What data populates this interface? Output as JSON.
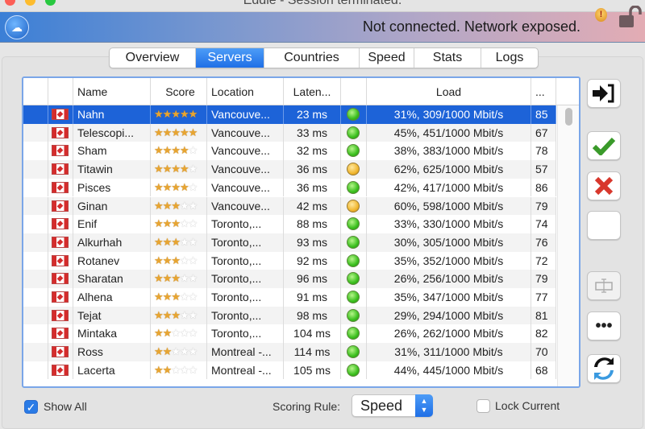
{
  "window": {
    "title": "Eddie - Session terminated."
  },
  "banner": {
    "status": "Not connected. Network exposed.",
    "logo_icon": "cloud-icon",
    "warning_icon": "warning-icon",
    "lock_icon": "unlocked-padlock-icon"
  },
  "tabs": [
    {
      "label": "Overview",
      "active": false
    },
    {
      "label": "Servers",
      "active": true
    },
    {
      "label": "Countries",
      "active": false
    },
    {
      "label": "Speed",
      "active": false
    },
    {
      "label": "Stats",
      "active": false
    },
    {
      "label": "Logs",
      "active": false
    }
  ],
  "table": {
    "columns": [
      "",
      "",
      "Name",
      "Score",
      "Location",
      "Laten...",
      "",
      "Load",
      "..."
    ],
    "rows": [
      {
        "name": "Nahn",
        "stars": 5,
        "location": "Vancouve...",
        "latency": "23 ms",
        "status": "green",
        "load": "31%, 309/1000 Mbit/s",
        "users": "85",
        "selected": true
      },
      {
        "name": "Telescopi...",
        "stars": 5,
        "location": "Vancouve...",
        "latency": "33 ms",
        "status": "green",
        "load": "45%, 451/1000 Mbit/s",
        "users": "67"
      },
      {
        "name": "Sham",
        "stars": 4,
        "location": "Vancouve...",
        "latency": "32 ms",
        "status": "green",
        "load": "38%, 383/1000 Mbit/s",
        "users": "78"
      },
      {
        "name": "Titawin",
        "stars": 4,
        "location": "Vancouve...",
        "latency": "36 ms",
        "status": "yellow",
        "load": "62%, 625/1000 Mbit/s",
        "users": "57"
      },
      {
        "name": "Pisces",
        "stars": 4,
        "location": "Vancouve...",
        "latency": "36 ms",
        "status": "green",
        "load": "42%, 417/1000 Mbit/s",
        "users": "86"
      },
      {
        "name": "Ginan",
        "stars": 3,
        "location": "Vancouve...",
        "latency": "42 ms",
        "status": "yellow",
        "load": "60%, 598/1000 Mbit/s",
        "users": "79"
      },
      {
        "name": "Enif",
        "stars": 3,
        "location": "Toronto,...",
        "latency": "88 ms",
        "status": "green",
        "load": "33%, 330/1000 Mbit/s",
        "users": "74"
      },
      {
        "name": "Alkurhah",
        "stars": 3,
        "location": "Toronto,...",
        "latency": "93 ms",
        "status": "green",
        "load": "30%, 305/1000 Mbit/s",
        "users": "76"
      },
      {
        "name": "Rotanev",
        "stars": 3,
        "location": "Toronto,...",
        "latency": "92 ms",
        "status": "green",
        "load": "35%, 352/1000 Mbit/s",
        "users": "72"
      },
      {
        "name": "Sharatan",
        "stars": 3,
        "location": "Toronto,...",
        "latency": "96 ms",
        "status": "green",
        "load": "26%, 256/1000 Mbit/s",
        "users": "79"
      },
      {
        "name": "Alhena",
        "stars": 3,
        "location": "Toronto,...",
        "latency": "91 ms",
        "status": "green",
        "load": "35%, 347/1000 Mbit/s",
        "users": "77"
      },
      {
        "name": "Tejat",
        "stars": 3,
        "location": "Toronto,...",
        "latency": "98 ms",
        "status": "green",
        "load": "29%, 294/1000 Mbit/s",
        "users": "81"
      },
      {
        "name": "Mintaka",
        "stars": 2,
        "location": "Toronto,...",
        "latency": "104 ms",
        "status": "green",
        "load": "26%, 262/1000 Mbit/s",
        "users": "82"
      },
      {
        "name": "Ross",
        "stars": 2,
        "location": "Montreal -...",
        "latency": "114 ms",
        "status": "green",
        "load": "31%, 311/1000 Mbit/s",
        "users": "70"
      },
      {
        "name": "Lacerta",
        "stars": 2,
        "location": "Montreal -...",
        "latency": "105 ms",
        "status": "green",
        "load": "44%, 445/1000 Mbit/s",
        "users": "68"
      }
    ]
  },
  "side_buttons": [
    "connect-icon",
    "allow-check-icon",
    "deny-x-icon",
    "blank",
    "rename-icon",
    "more-icon",
    "refresh-icon"
  ],
  "footer": {
    "show_all_label": "Show All",
    "show_all_checked": true,
    "scoring_label": "Scoring Rule:",
    "scoring_value": "Speed",
    "lock_label": "Lock Current",
    "lock_checked": false
  },
  "colors": {
    "selection": "#1d63d8",
    "accent": "#2a7be6",
    "status_green": "#3bbf1e",
    "status_yellow": "#f0b730"
  }
}
